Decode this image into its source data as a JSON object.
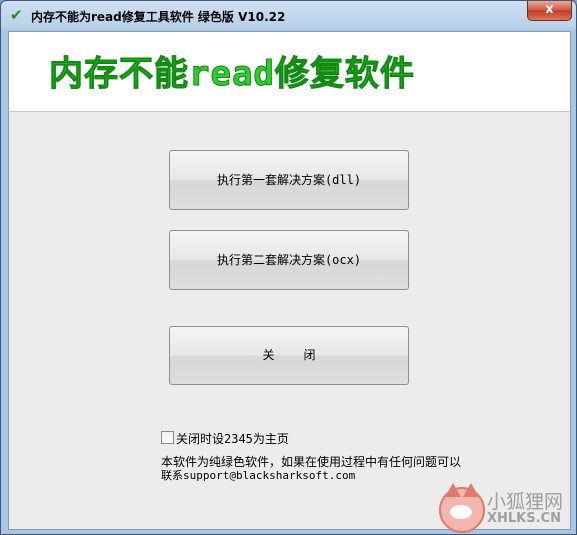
{
  "window": {
    "title": "内存不能为read修复工具软件 绿色版 V10.22",
    "close_label": "x"
  },
  "banner": {
    "text": "内存不能read修复软件"
  },
  "buttons": {
    "fix_dll": "执行第一套解决方案(dll)",
    "fix_ocx": "执行第二套解决方案(ocx)",
    "close": "关    闭"
  },
  "options": {
    "set_homepage_label": "关闭时设2345为主页",
    "set_homepage_checked": false
  },
  "info": {
    "line1": "本软件为纯绿色软件，如果在使用过程中有任何问题可以",
    "line2": "联系support@blacksharksoft.com"
  },
  "watermark": {
    "name": "小狐狸网",
    "domain": "XHLKS.CN"
  },
  "icons": {
    "title_icon": "checkmark-icon",
    "watermark_icon": "fox-icon"
  }
}
